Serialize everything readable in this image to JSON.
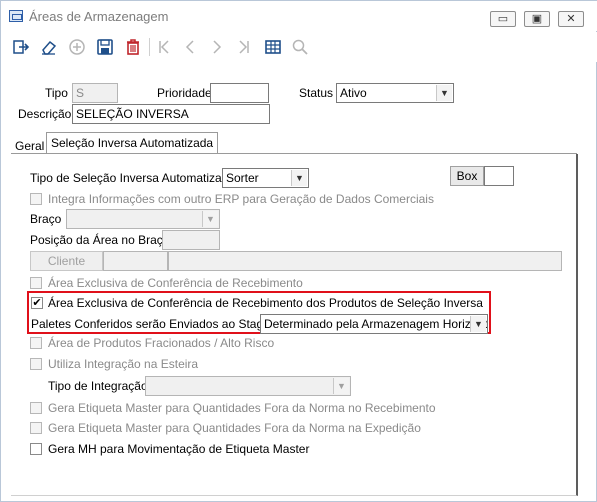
{
  "window": {
    "title": "Áreas de Armazenagem",
    "buttons": {
      "minimize": "▭",
      "restore": "▣",
      "close": "✕"
    }
  },
  "toolbar": {
    "icons": [
      "exit-icon",
      "eraser-icon",
      "add-icon",
      "save-icon",
      "delete-icon",
      "first-icon",
      "previous-icon",
      "next-icon",
      "last-icon",
      "grid-icon",
      "search-icon"
    ]
  },
  "form": {
    "tipo_label": "Tipo",
    "tipo_value": "S",
    "prioridade_label": "Prioridade",
    "prioridade_value": "",
    "status_label": "Status",
    "status_value": "Ativo",
    "descricao_label": "Descrição",
    "descricao_value": "SELEÇÃO INVERSA"
  },
  "tabs": {
    "geral": "Geral",
    "selecao": "Seleção Inversa Automatizada"
  },
  "panel": {
    "tipo_selecao_label": "Tipo de Seleção Inversa Automatizada",
    "tipo_selecao_value": "Sorter",
    "box_label": "Box",
    "integra_label": "Integra Informações com outro ERP para Geração de Dados Comerciais",
    "braco_label": "Braço",
    "posicao_label": "Posição da Área no Braço",
    "cliente_button": "Cliente",
    "area_exclusiva_label": "Área Exclusiva de Conferência de Recebimento",
    "area_exclusiva_produtos_label": "Área Exclusiva de Conferência de Recebimento dos Produtos de Seleção Inversa",
    "paletes_label": "Paletes Conferidos serão Enviados ao Stage-In",
    "paletes_value": "Determinado pela Armazenagem Horizontal",
    "area_fracionados_label": "Área de Produtos Fracionados / Alto Risco",
    "utiliza_esteira_label": "Utiliza Integração na Esteira",
    "tipo_integracao_label": "Tipo de Integração",
    "etiqueta_recebimento_label": "Gera Etiqueta Master para Quantidades Fora da Norma no Recebimento",
    "etiqueta_expedicao_label": "Gera Etiqueta Master para Quantidades Fora da Norma na Expedição",
    "gera_mh_label": "Gera MH para Movimentação de Etiqueta Master",
    "check_mark": "✔"
  },
  "colors": {
    "highlight": "#e0101a",
    "toolbar_icon": "#1f4f8a",
    "delete_icon": "#c0262c"
  }
}
